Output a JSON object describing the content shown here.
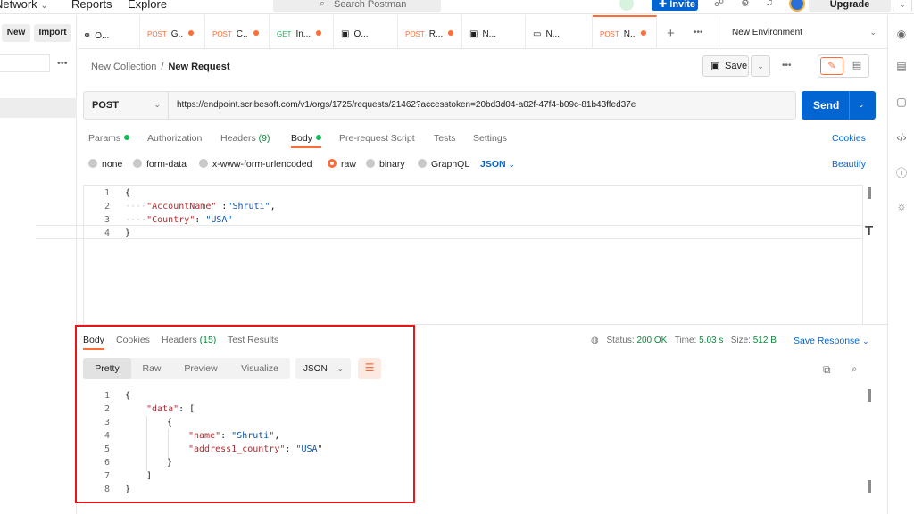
{
  "topnav": {
    "network": "Network",
    "network_caret": "⌄",
    "reports": "Reports",
    "explore": "Explore",
    "search_placeholder": "Search Postman",
    "invite": "Invite",
    "upgrade": "Upgrade"
  },
  "sidebar": {
    "new_label": "New",
    "import_label": "Import",
    "more": "•••"
  },
  "tabs": [
    {
      "method": "",
      "label": "O...",
      "icon": "collection-icon",
      "dot": false
    },
    {
      "method": "POST",
      "label": "G..",
      "dot": true
    },
    {
      "method": "POST",
      "label": "C..",
      "dot": true
    },
    {
      "method": "GET",
      "label": "In...",
      "dot": true
    },
    {
      "method": "",
      "label": "O...",
      "icon": "example-icon",
      "dot": false
    },
    {
      "method": "POST",
      "label": "R...",
      "dot": true
    },
    {
      "method": "",
      "label": "N...",
      "icon": "example-icon",
      "dot": false
    },
    {
      "method": "",
      "label": "N...",
      "icon": "document-icon",
      "dot": false
    },
    {
      "method": "POST",
      "label": "N..",
      "dot": true,
      "active": true
    }
  ],
  "tabs_more": "•••",
  "environment": "New Environment",
  "breadcrumb": {
    "parent": "New Collection",
    "separator": "/",
    "current": "New Request"
  },
  "toolbar": {
    "save_label": "Save",
    "more": "•••"
  },
  "request": {
    "method": "POST",
    "url": "https://endpoint.scribesoft.com/v1/orgs/1725/requests/21462?accesstoken=20bd3d04-a02f-47f4-b09c-81b43ffed37e",
    "send_label": "Send"
  },
  "request_tabs": {
    "params": "Params",
    "authorization": "Authorization",
    "headers": "Headers",
    "headers_count": "(9)",
    "body": "Body",
    "prerequest": "Pre-request Script",
    "tests": "Tests",
    "settings": "Settings",
    "cookies": "Cookies"
  },
  "body_types": {
    "none": "none",
    "form_data": "form-data",
    "urlencoded": "x-www-form-urlencoded",
    "raw": "raw",
    "binary": "binary",
    "graphql": "GraphQL",
    "language": "JSON",
    "beautify": "Beautify"
  },
  "request_body_lines": [
    {
      "n": "1",
      "text": "{"
    },
    {
      "n": "2",
      "key": "\"AccountName\"",
      "sep": " :",
      "val": "\"Shruti\"",
      "end": ","
    },
    {
      "n": "3",
      "key": "\"Country\"",
      "sep": ": ",
      "val": "\"USA\"",
      "end": ""
    },
    {
      "n": "4",
      "text": "}"
    }
  ],
  "response_tabs": {
    "body": "Body",
    "cookies": "Cookies",
    "headers": "Headers",
    "headers_count": "(15)",
    "test_results": "Test Results"
  },
  "response_status": {
    "status_label": "Status:",
    "status_value": "200 OK",
    "time_label": "Time:",
    "time_value": "5.03 s",
    "size_label": "Size:",
    "size_value": "512 B",
    "save_response": "Save Response"
  },
  "response_view": {
    "pretty": "Pretty",
    "raw": "Raw",
    "preview": "Preview",
    "visualize": "Visualize",
    "format": "JSON"
  },
  "response_body_lines": [
    {
      "n": "1",
      "text": "{"
    },
    {
      "n": "2",
      "key": "\"data\"",
      "rest": ": ["
    },
    {
      "n": "3",
      "text": "{"
    },
    {
      "n": "4",
      "key": "\"name\"",
      "sep": ": ",
      "val": "\"Shruti\"",
      "end": ","
    },
    {
      "n": "5",
      "key": "\"address1_country\"",
      "sep": ": ",
      "val": "\"USA\"",
      "end": ""
    },
    {
      "n": "6",
      "text": "}"
    },
    {
      "n": "7",
      "text": "]"
    },
    {
      "n": "8",
      "text": "}"
    }
  ],
  "colors": {
    "accent": "#ff6c37",
    "primary": "#0265d2",
    "success": "#0a8a3a",
    "highlight_box": "#e8141b"
  }
}
